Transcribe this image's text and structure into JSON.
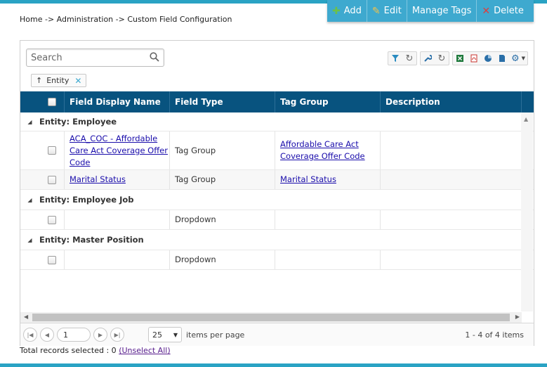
{
  "breadcrumb": "Home -> Administration -> Custom Field Configuration",
  "toolbar": {
    "add_label": "Add",
    "edit_label": "Edit",
    "manage_tags_label": "Manage Tags",
    "delete_label": "Delete"
  },
  "search": {
    "placeholder": "Search"
  },
  "filter_chip": {
    "label": "Entity"
  },
  "columns": {
    "field_display_name": "Field Display Name",
    "field_type": "Field Type",
    "tag_group": "Tag Group",
    "description": "Description"
  },
  "groups": [
    {
      "label": "Entity: Employee",
      "rows": [
        {
          "name": "ACA_COC - Affordable Care Act Coverage Offer Code",
          "type": "Tag Group",
          "tag_group": "Affordable Care Act Coverage Offer Code",
          "description": ""
        },
        {
          "name": "Marital Status",
          "type": "Tag Group",
          "tag_group": "Marital Status",
          "description": ""
        }
      ]
    },
    {
      "label": "Entity: Employee Job",
      "rows": [
        {
          "name": "",
          "type": "Dropdown",
          "tag_group": "",
          "description": ""
        }
      ]
    },
    {
      "label": "Entity: Master Position",
      "rows": [
        {
          "name": "",
          "type": "Dropdown",
          "tag_group": "",
          "description": ""
        }
      ]
    }
  ],
  "pager": {
    "current_page": "1",
    "page_size": "25",
    "items_per_page_label": "items per page",
    "range_text": "1 - 4 of 4 items"
  },
  "footer": {
    "total_text": "Total records selected : 0",
    "unselect_label": "(Unselect All)"
  },
  "colors": {
    "accent": "#3ea9cf",
    "header_bg": "#08537f"
  },
  "icons": [
    "plus-icon",
    "pencil-icon",
    "x-icon",
    "search-icon",
    "filter-icon",
    "refresh-icon",
    "wrench-icon",
    "excel-icon",
    "pdf-icon",
    "chart-icon",
    "document-icon",
    "gear-icon"
  ]
}
